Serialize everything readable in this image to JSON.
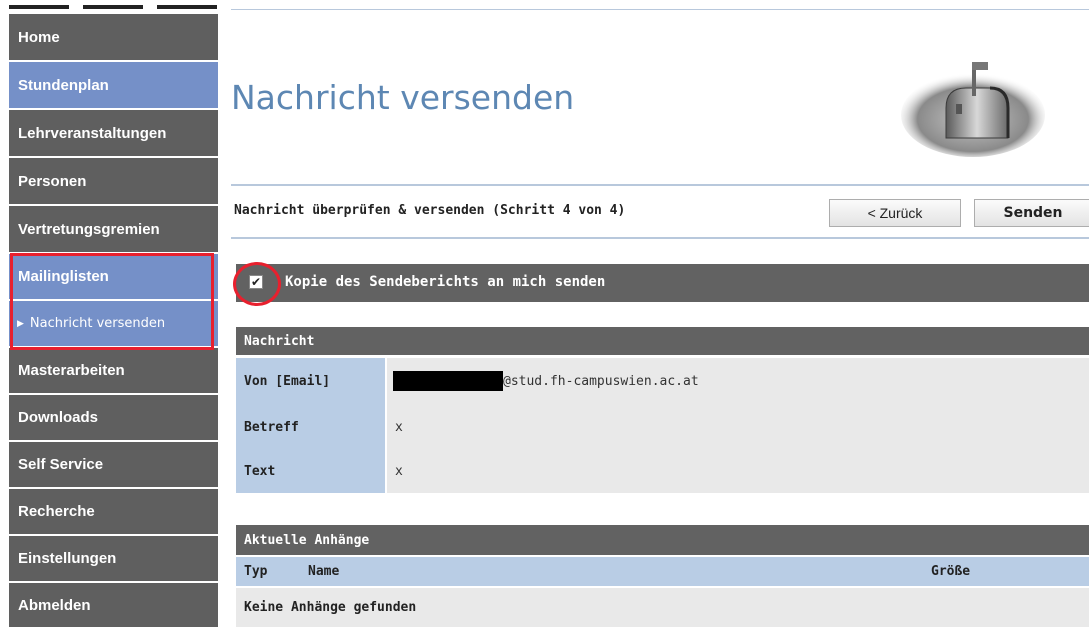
{
  "sidebar": {
    "items": [
      {
        "label": "Home"
      },
      {
        "label": "Stundenplan"
      },
      {
        "label": "Lehrveranstaltungen"
      },
      {
        "label": "Personen"
      },
      {
        "label": "Vertretungsgremien"
      },
      {
        "label": "Mailinglisten"
      },
      {
        "label": "Nachricht versenden"
      },
      {
        "label": "Masterarbeiten"
      },
      {
        "label": "Downloads"
      },
      {
        "label": "Self Service"
      },
      {
        "label": "Recherche"
      },
      {
        "label": "Einstellungen"
      },
      {
        "label": "Abmelden"
      }
    ]
  },
  "page": {
    "title": "Nachricht versenden",
    "icon": "mailbox-icon"
  },
  "step": {
    "text": "Nachricht überprüfen & versenden (Schritt 4 von 4)",
    "back_label": "< Zurück",
    "send_label": "Senden"
  },
  "copy_option": {
    "label": "Kopie des Sendeberichts an mich senden",
    "checked": true
  },
  "message": {
    "heading": "Nachricht",
    "from_label": "Von [Email]",
    "from_value": "@stud.fh-campuswien.ac.at",
    "subject_label": "Betreff",
    "subject_value": "x",
    "text_label": "Text",
    "text_value": "x"
  },
  "attachments": {
    "heading": "Aktuelle Anhänge",
    "columns": [
      "Typ",
      "Name",
      "Größe"
    ],
    "empty_text": "Keine Anhänge gefunden"
  },
  "colors": {
    "nav_dark": "#5f5f5f",
    "nav_blue": "#7590c8",
    "title_blue": "#5d87b3",
    "highlight_red": "#e8202e"
  }
}
